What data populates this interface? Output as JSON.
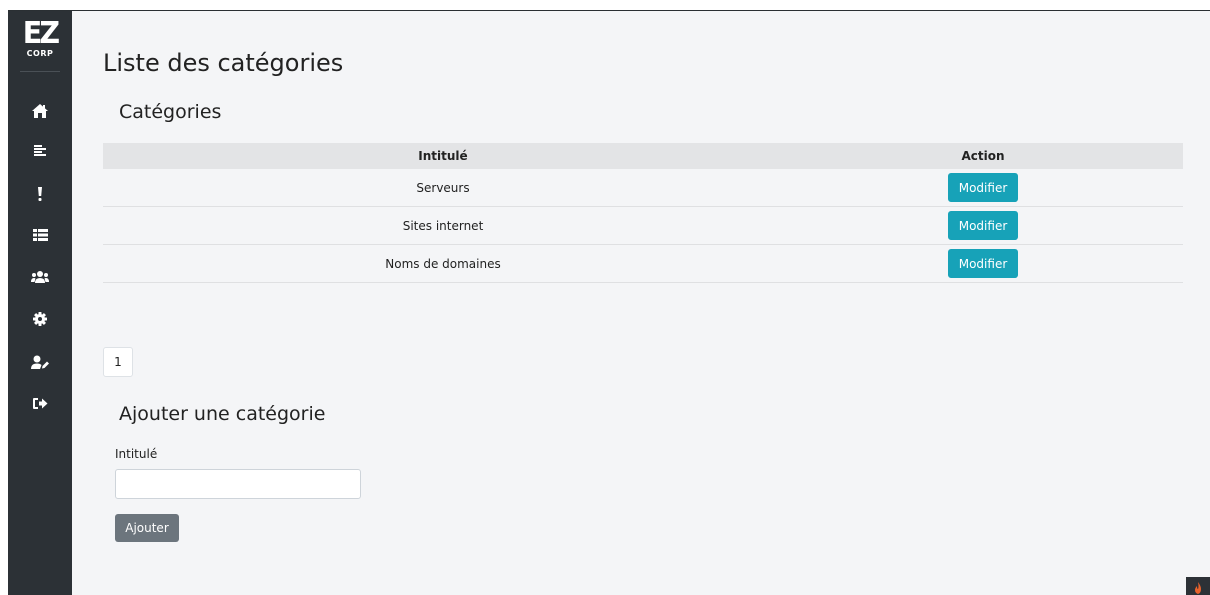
{
  "logo": {
    "line1": "EZ",
    "line2": "CORP"
  },
  "sidebar": {
    "items": [
      {
        "name": "home",
        "icon": "home-icon"
      },
      {
        "name": "list",
        "icon": "list-icon"
      },
      {
        "name": "alerts",
        "icon": "exclamation-icon"
      },
      {
        "name": "categories",
        "icon": "table-list-icon"
      },
      {
        "name": "users",
        "icon": "users-icon"
      },
      {
        "name": "settings",
        "icon": "gear-icon"
      },
      {
        "name": "edit-user",
        "icon": "user-edit-icon"
      },
      {
        "name": "logout",
        "icon": "sign-out-icon"
      }
    ]
  },
  "page": {
    "title": "Liste des catégories",
    "section_title": "Catégories"
  },
  "table": {
    "headers": [
      "Intitulé",
      "Action"
    ],
    "rows": [
      {
        "name": "Serveurs",
        "action": "Modifier"
      },
      {
        "name": "Sites internet",
        "action": "Modifier"
      },
      {
        "name": "Noms de domaines",
        "action": "Modifier"
      }
    ]
  },
  "pagination": {
    "current": "1"
  },
  "add_form": {
    "title": "Ajouter une catégorie",
    "label": "Intitulé",
    "value": "",
    "submit_label": "Ajouter"
  },
  "colors": {
    "sidebar": "#2c3136",
    "primary_button": "#17a2b8",
    "secondary_button": "#6c757d",
    "table_header": "#e3e4e6",
    "background": "#f4f5f7"
  }
}
